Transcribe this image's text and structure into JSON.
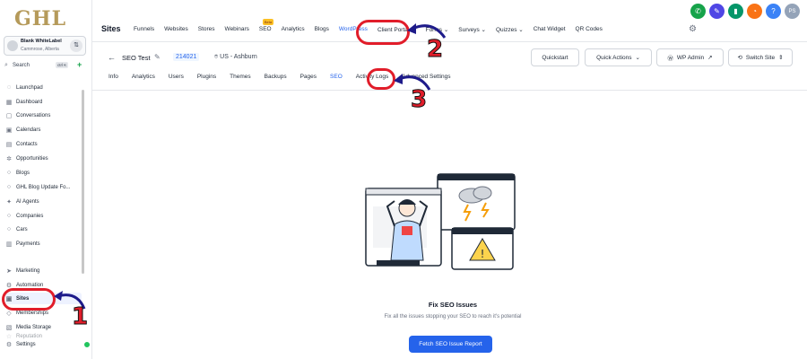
{
  "brand": {
    "logo_text": "GHL"
  },
  "account": {
    "name": "Blank WhiteLabel",
    "location": "Cammrose, Alberta"
  },
  "sidebar": {
    "search_label": "Search",
    "search_shortcut": "ctrl K",
    "items": [
      {
        "label": "Launchpad",
        "icon": "rocket-icon"
      },
      {
        "label": "Dashboard",
        "icon": "dashboard-icon"
      },
      {
        "label": "Conversations",
        "icon": "chat-icon"
      },
      {
        "label": "Calendars",
        "icon": "calendar-icon"
      },
      {
        "label": "Contacts",
        "icon": "contacts-icon"
      },
      {
        "label": "Opportunities",
        "icon": "opportunities-icon"
      },
      {
        "label": "Blogs",
        "icon": "blog-icon"
      },
      {
        "label": "GHL Blog Update Fo...",
        "icon": "blog-icon"
      },
      {
        "label": "AI Agents",
        "icon": "ai-icon"
      },
      {
        "label": "Companies",
        "icon": "company-icon"
      },
      {
        "label": "Cars",
        "icon": "car-icon"
      },
      {
        "label": "Payments",
        "icon": "payments-icon"
      },
      {
        "label": "Marketing",
        "icon": "send-icon"
      },
      {
        "label": "Automation",
        "icon": "automation-icon"
      },
      {
        "label": "Sites",
        "icon": "sites-icon"
      },
      {
        "label": "Memberships",
        "icon": "membership-icon"
      },
      {
        "label": "Media Storage",
        "icon": "media-icon"
      },
      {
        "label": "Reputation",
        "icon": "star-icon"
      },
      {
        "label": "Settings",
        "icon": "gear-icon"
      }
    ]
  },
  "topbar": {
    "title": "Sites",
    "tabs": [
      {
        "label": "Funnels"
      },
      {
        "label": "Websites"
      },
      {
        "label": "Stores"
      },
      {
        "label": "Webinars"
      },
      {
        "label": "SEO",
        "badge": "Beta"
      },
      {
        "label": "Analytics"
      },
      {
        "label": "Blogs"
      },
      {
        "label": "WordPress"
      },
      {
        "label": "Client Portal ⌄"
      },
      {
        "label": "Forms ⌄"
      },
      {
        "label": "Surveys ⌄"
      },
      {
        "label": "Quizzes ⌄"
      },
      {
        "label": "Chat Widget"
      },
      {
        "label": "QR Codes"
      }
    ],
    "avatar_initials": "PS"
  },
  "site": {
    "name": "SEO Test",
    "id": "214021",
    "location": "US - Ashburn",
    "buttons": {
      "quickstart": "Quickstart",
      "quick_actions": "Quick Actions",
      "wp_admin": "WP Admin",
      "switch_site": "Switch Site"
    },
    "tabs": [
      {
        "label": "Info"
      },
      {
        "label": "Analytics"
      },
      {
        "label": "Users"
      },
      {
        "label": "Plugins"
      },
      {
        "label": "Themes"
      },
      {
        "label": "Backups"
      },
      {
        "label": "Pages"
      },
      {
        "label": "SEO"
      },
      {
        "label": "Activity Logs"
      },
      {
        "label": "Advanced Settings"
      }
    ]
  },
  "empty_state": {
    "title": "Fix SEO Issues",
    "description": "Fix all the issues stopping your SEO to reach it's potential",
    "button": "Fetch SEO Issue Report"
  },
  "callouts": {
    "one": "1",
    "two": "2",
    "three": "3"
  },
  "colors": {
    "accent": "#2563eb",
    "callout": "#e11d2a",
    "logo": "#b59a5a"
  }
}
